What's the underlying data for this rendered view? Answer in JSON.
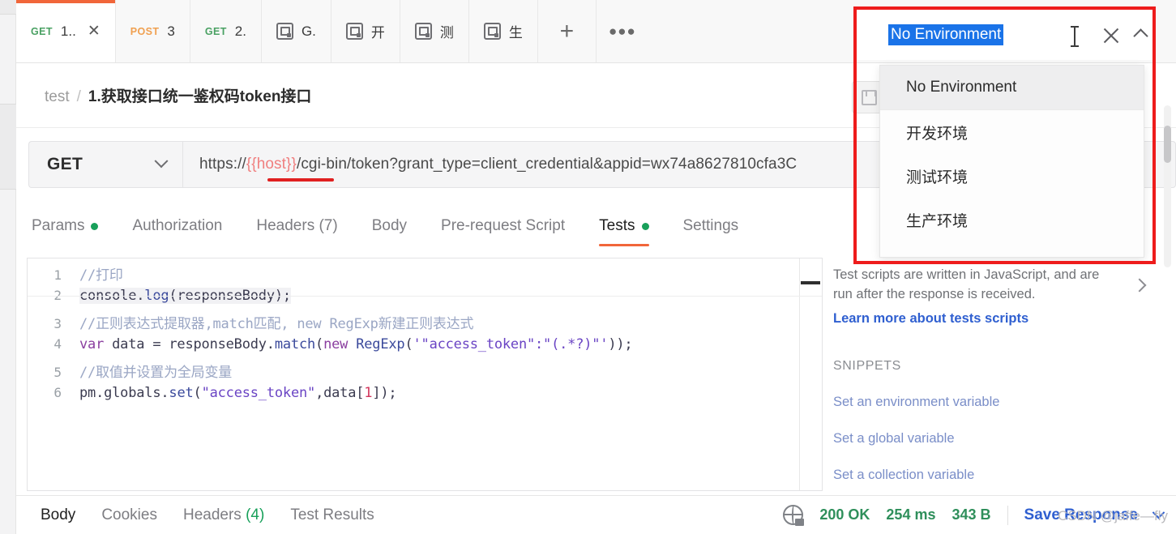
{
  "request_tabs": [
    {
      "method": "GET",
      "method_class": "m-get",
      "label": "1..",
      "icon": "",
      "active": true,
      "closable": true
    },
    {
      "method": "POST",
      "method_class": "m-post",
      "label": "3",
      "icon": "",
      "active": false,
      "closable": false
    },
    {
      "method": "GET",
      "method_class": "m-get",
      "label": "2.",
      "icon": "",
      "active": false,
      "closable": false
    },
    {
      "method": "",
      "method_class": "",
      "label": "G.",
      "icon": "collection-icon",
      "active": false,
      "closable": false
    },
    {
      "method": "",
      "method_class": "",
      "label": "开",
      "icon": "collection-icon",
      "active": false,
      "closable": false
    },
    {
      "method": "",
      "method_class": "",
      "label": "测",
      "icon": "collection-icon",
      "active": false,
      "closable": false
    },
    {
      "method": "",
      "method_class": "",
      "label": "生",
      "icon": "collection-icon",
      "active": false,
      "closable": false
    }
  ],
  "tabbar": {
    "new_tab_label": "+",
    "more_label": "●●●"
  },
  "breadcrumb": {
    "collection": "test",
    "separator": "/",
    "request_name": "1.获取接口统一鉴权码token接口"
  },
  "url_bar": {
    "method": "GET",
    "url_prefix": "https://",
    "url_variable": "{{host}}",
    "url_suffix": "/cgi-bin/token?grant_type=client_credential&appid=wx74a8627810cfa3C"
  },
  "section_tabs": [
    {
      "label": "Params",
      "dot": true,
      "active": false
    },
    {
      "label": "Authorization",
      "dot": false,
      "active": false
    },
    {
      "label": "Headers (7)",
      "dot": false,
      "active": false
    },
    {
      "label": "Body",
      "dot": false,
      "active": false
    },
    {
      "label": "Pre-request Script",
      "dot": false,
      "active": false
    },
    {
      "label": "Tests",
      "dot": true,
      "active": true
    },
    {
      "label": "Settings",
      "dot": false,
      "active": false
    }
  ],
  "code": {
    "lines": [
      {
        "n": "1",
        "segments": [
          {
            "t": "//打印",
            "c": "c-com"
          }
        ]
      },
      {
        "n": "2",
        "segments": [
          {
            "t": "console",
            "c": "c-plain"
          },
          {
            "t": ".",
            "c": "c-plain"
          },
          {
            "t": "log",
            "c": "c-fn"
          },
          {
            "t": "(responseBody);",
            "c": "c-plain"
          }
        ]
      },
      {
        "n": "3",
        "segments": [
          {
            "t": "//正则表达式提取器,match匹配, new RegExp新建正则表达式",
            "c": "c-com"
          }
        ]
      },
      {
        "n": "4",
        "segments": [
          {
            "t": "var",
            "c": "c-kw"
          },
          {
            "t": " data = responseBody.",
            "c": "c-plain"
          },
          {
            "t": "match",
            "c": "c-fn"
          },
          {
            "t": "(",
            "c": "c-plain"
          },
          {
            "t": "new",
            "c": "c-kw"
          },
          {
            "t": " ",
            "c": "c-plain"
          },
          {
            "t": "RegExp",
            "c": "c-fn"
          },
          {
            "t": "(",
            "c": "c-plain"
          },
          {
            "t": "'\"access_token\":\"(.*?)\"'",
            "c": "c-str"
          },
          {
            "t": "));",
            "c": "c-plain"
          }
        ]
      },
      {
        "n": "5",
        "segments": [
          {
            "t": "//取值并设置为全局变量",
            "c": "c-com"
          }
        ]
      },
      {
        "n": "6",
        "segments": [
          {
            "t": "pm",
            "c": "c-plain"
          },
          {
            "t": ".globals.",
            "c": "c-plain"
          },
          {
            "t": "set",
            "c": "c-fn"
          },
          {
            "t": "(",
            "c": "c-plain"
          },
          {
            "t": "\"access_token\"",
            "c": "c-str"
          },
          {
            "t": ",data[",
            "c": "c-plain"
          },
          {
            "t": "1",
            "c": "c-num"
          },
          {
            "t": "]);",
            "c": "c-plain"
          }
        ]
      }
    ]
  },
  "info_panel": {
    "description": "Test scripts are written in JavaScript, and are run after the response is received.",
    "learn_more": "Learn more about tests scripts",
    "snippets_title": "SNIPPETS",
    "snippets": [
      "Set an environment variable",
      "Set a global variable",
      "Set a collection variable"
    ]
  },
  "environment": {
    "selected": "No Environment",
    "options": [
      {
        "label": "No Environment",
        "selected": true
      },
      {
        "label": "开发环境",
        "selected": false
      },
      {
        "label": "测试环境",
        "selected": false
      },
      {
        "label": "生产环境",
        "selected": false
      }
    ]
  },
  "response_tabs": [
    {
      "label": "Body",
      "count": "",
      "active": true
    },
    {
      "label": "Cookies",
      "count": "",
      "active": false
    },
    {
      "label": "Headers",
      "count": "(4)",
      "active": false
    },
    {
      "label": "Test Results",
      "count": "",
      "active": false
    }
  ],
  "status": {
    "code": "200 OK",
    "time": "254 ms",
    "size": "343 B",
    "save_response": "Save Response"
  },
  "watermark": "CSDN @jaffe—fly"
}
